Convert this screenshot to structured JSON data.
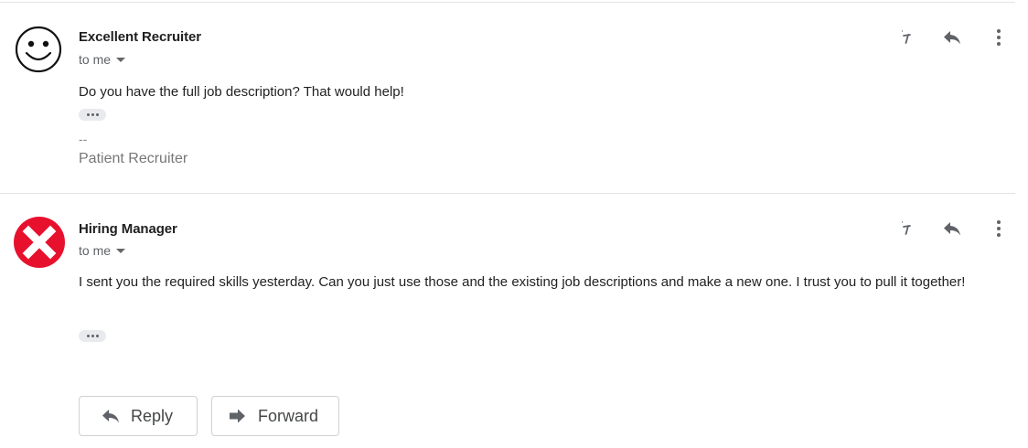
{
  "messages": [
    {
      "sender": "Excellent Recruiter",
      "recipient": "to me",
      "body": "Do you have the full job description?  That would help!",
      "signature_dashes": "--",
      "signature_name": "Patient Recruiter",
      "avatar": "smiley-face-icon"
    },
    {
      "sender": "Hiring Manager",
      "recipient": "to me",
      "body": "I sent you the required skills yesterday.  Can you just use those and the existing job descriptions and make a new one.  I trust you to pull it together!",
      "avatar": "red-x-icon"
    }
  ],
  "buttons": {
    "reply": "Reply",
    "forward": "Forward"
  },
  "icons": {
    "reply": "reply-arrow-icon",
    "forward": "forward-arrow-icon",
    "more": "more-vertical-icon",
    "emoji_react": "emoji-react-icon",
    "expand": "ellipsis-icon",
    "dropdown": "caret-down-icon"
  },
  "colors": {
    "avatar_red": "#e8112d",
    "icon_gray": "#5f6368",
    "divider": "#e4e4e4",
    "signature": "#777777"
  }
}
